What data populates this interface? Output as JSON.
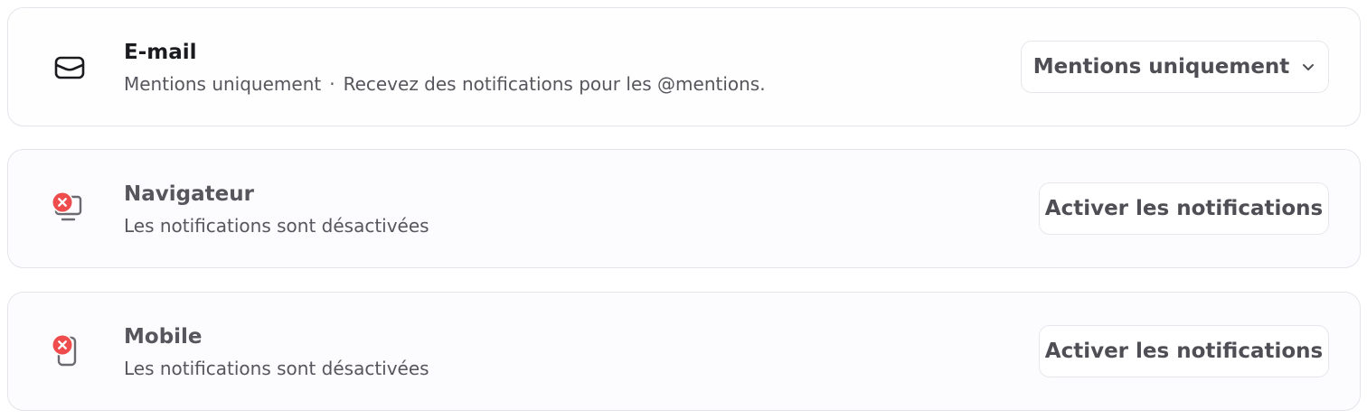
{
  "channels": [
    {
      "title": "E-mail",
      "status": "Mentions uniquement",
      "separator": "·",
      "description": "Recevez des notifications pour les @mentions.",
      "icon": "envelope-icon",
      "control": {
        "type": "dropdown",
        "selected": "Mentions uniquement",
        "icon": "chevron-down-icon"
      }
    },
    {
      "title": "Navigateur",
      "status": "Les notifications sont désactivées",
      "icon": "monitor-icon",
      "badge_icon": "error-x-icon",
      "control": {
        "type": "button",
        "label": "Activer les notifications"
      }
    },
    {
      "title": "Mobile",
      "status": "Les notifications sont désactivées",
      "icon": "smartphone-icon",
      "badge_icon": "error-x-icon",
      "control": {
        "type": "button",
        "label": "Activer les notifications"
      }
    }
  ],
  "colors": {
    "error_badge": "#ef4d4d",
    "title_active": "#1b1b1f",
    "text_muted": "#58565d",
    "border": "#e6e3ea"
  }
}
